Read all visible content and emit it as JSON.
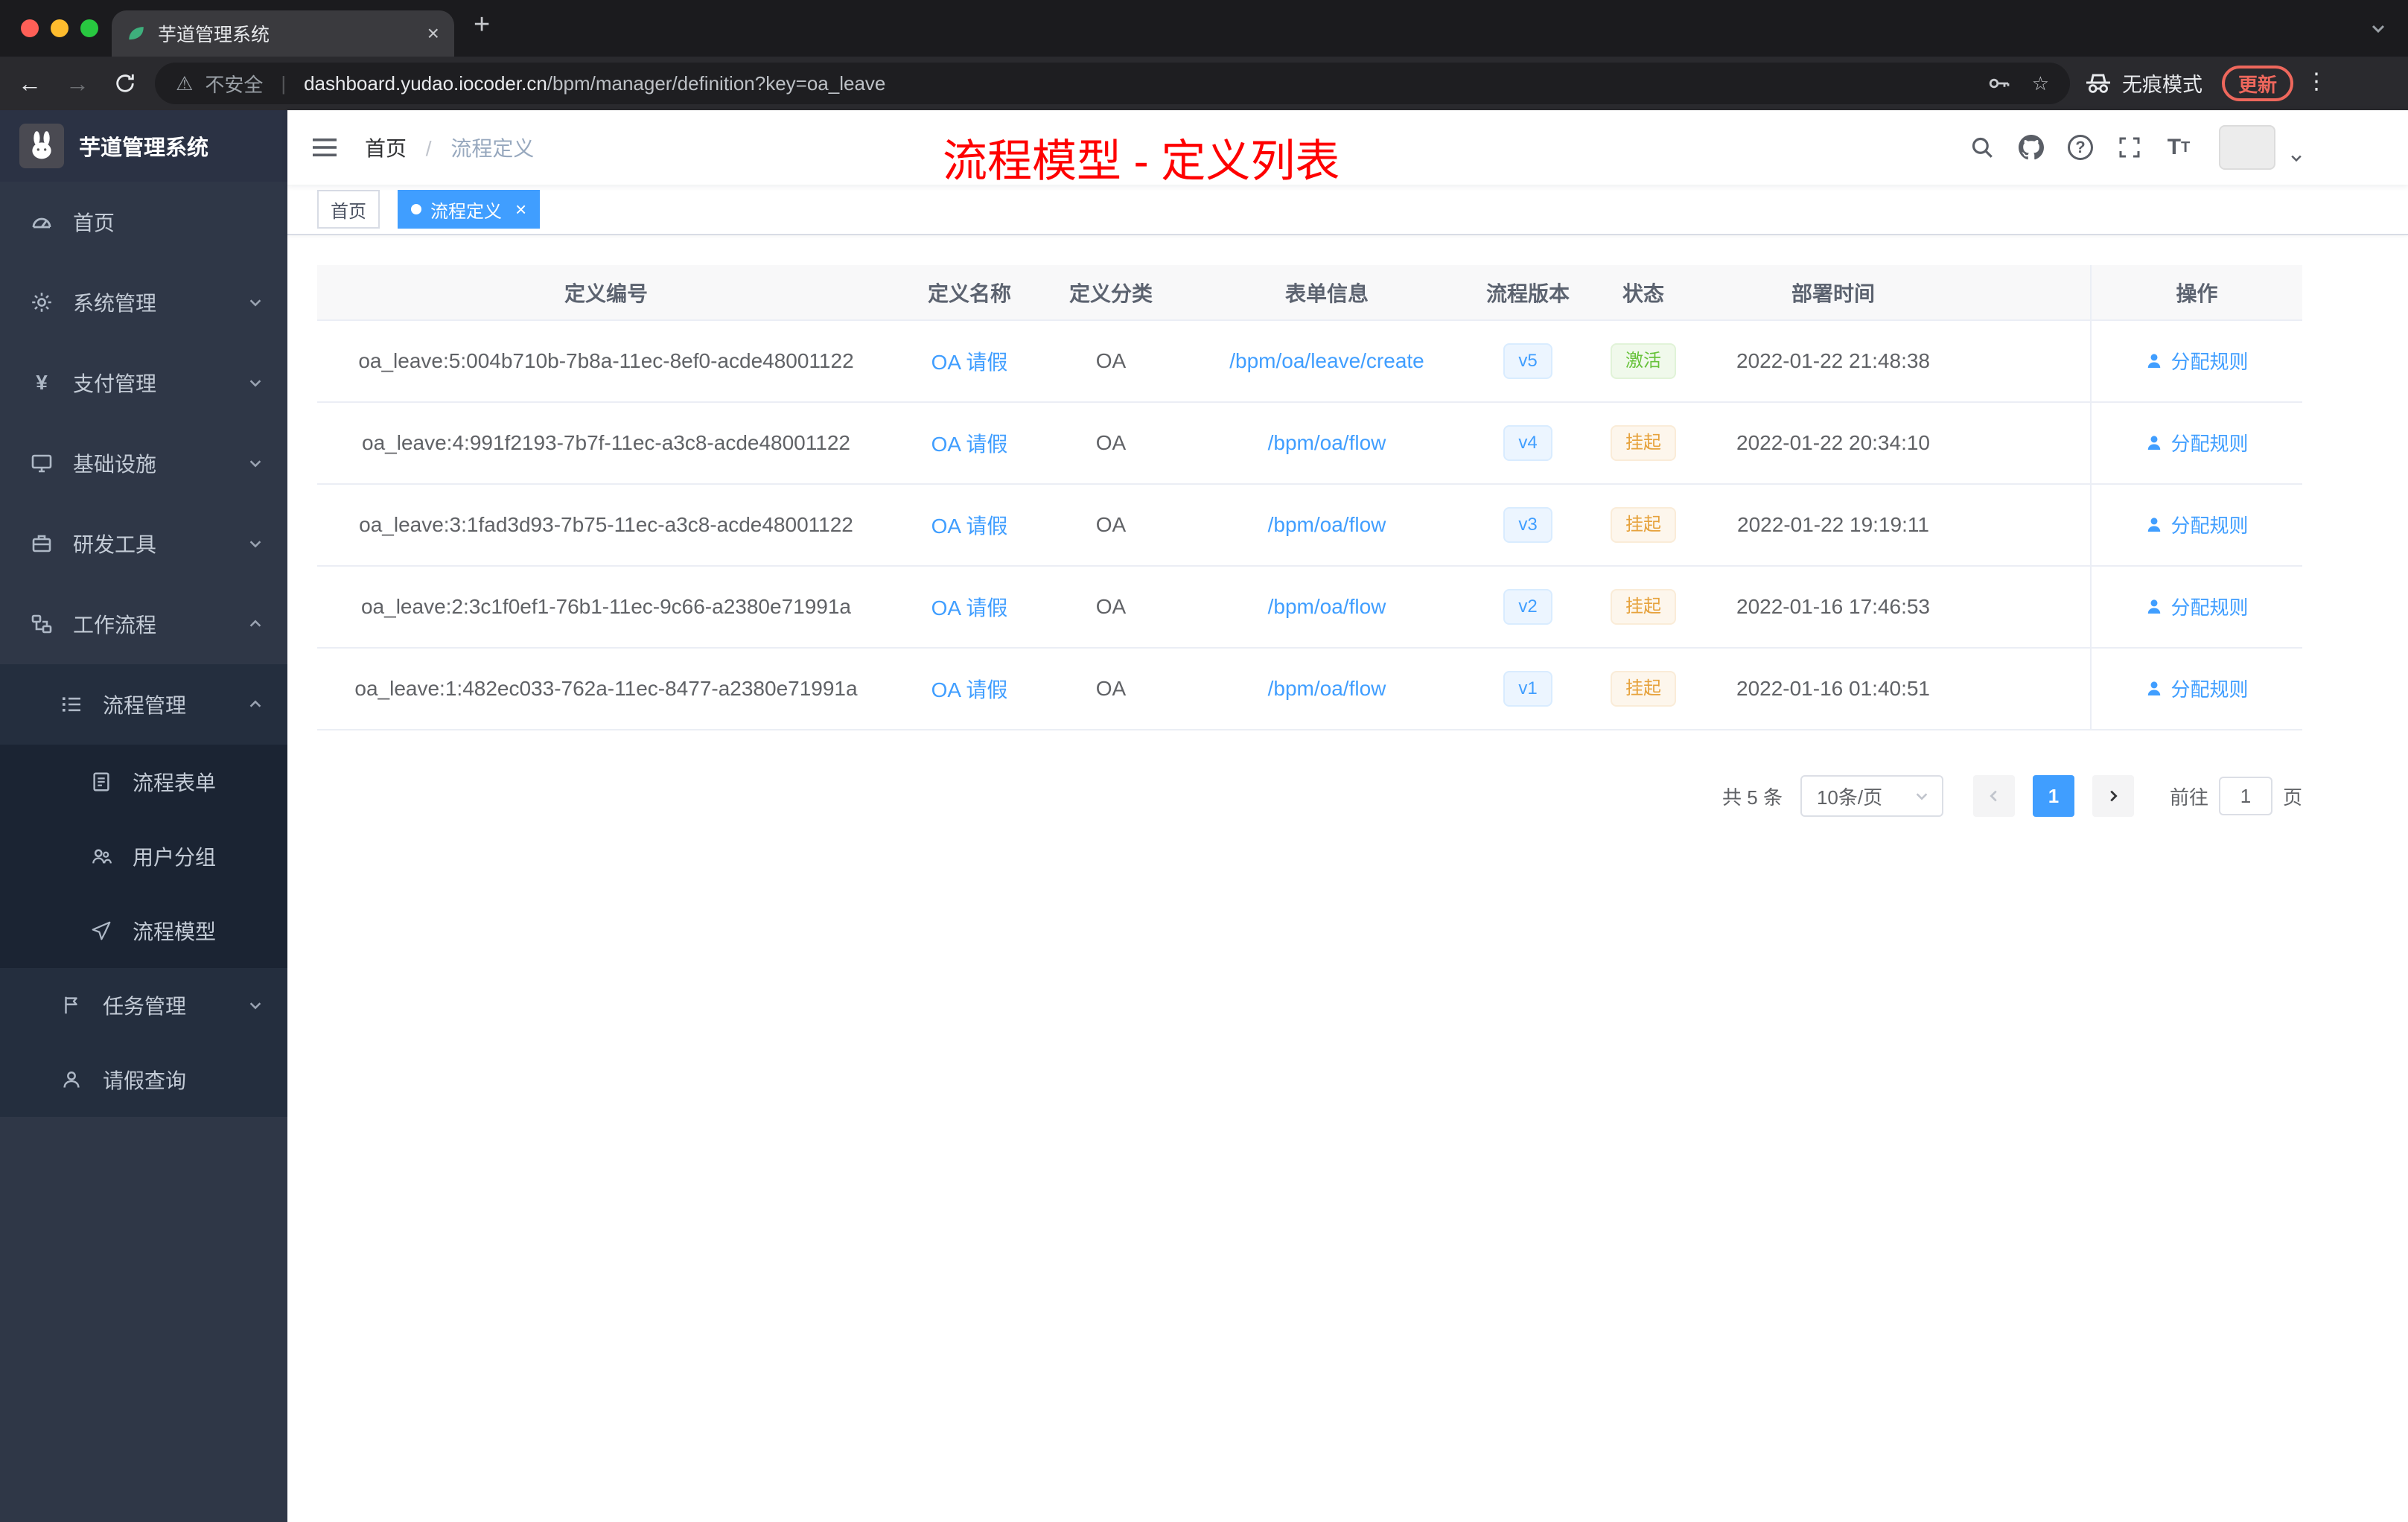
{
  "browser": {
    "tab_title": "芋道管理系统",
    "new_tab": "+",
    "close_tab": "×",
    "security_label": "不安全",
    "url_domain": "dashboard.yudao.iocoder.cn",
    "url_path": "/bpm/manager/definition?key=oa_leave",
    "incognito_label": "无痕模式",
    "update_label": "更新"
  },
  "sidebar": {
    "brand": "芋道管理系统",
    "items": [
      {
        "label": "首页"
      },
      {
        "label": "系统管理"
      },
      {
        "label": "支付管理"
      },
      {
        "label": "基础设施"
      },
      {
        "label": "研发工具"
      },
      {
        "label": "工作流程"
      },
      {
        "label": "流程管理"
      },
      {
        "label": "流程表单"
      },
      {
        "label": "用户分组"
      },
      {
        "label": "流程模型"
      },
      {
        "label": "任务管理"
      },
      {
        "label": "请假查询"
      }
    ]
  },
  "navbar": {
    "breadcrumb_home": "首页",
    "breadcrumb_sep": "/",
    "breadcrumb_current": "流程定义",
    "overlay_title": "流程模型 - 定义列表",
    "question_mark": "?"
  },
  "tags": {
    "home": "首页",
    "current": "流程定义",
    "close": "×"
  },
  "table": {
    "columns": [
      "定义编号",
      "定义名称",
      "定义分类",
      "表单信息",
      "流程版本",
      "状态",
      "部署时间",
      "操作"
    ],
    "action_label": "分配规则",
    "rows": [
      {
        "id": "oa_leave:5:004b710b-7b8a-11ec-8ef0-acde48001122",
        "name": "OA 请假",
        "category": "OA",
        "form": "/bpm/oa/leave/create",
        "version": "v5",
        "status": "激活",
        "time": "2022-01-22 21:48:38"
      },
      {
        "id": "oa_leave:4:991f2193-7b7f-11ec-a3c8-acde48001122",
        "name": "OA 请假",
        "category": "OA",
        "form": "/bpm/oa/flow",
        "version": "v4",
        "status": "挂起",
        "time": "2022-01-22 20:34:10"
      },
      {
        "id": "oa_leave:3:1fad3d93-7b75-11ec-a3c8-acde48001122",
        "name": "OA 请假",
        "category": "OA",
        "form": "/bpm/oa/flow",
        "version": "v3",
        "status": "挂起",
        "time": "2022-01-22 19:19:11"
      },
      {
        "id": "oa_leave:2:3c1f0ef1-76b1-11ec-9c66-a2380e71991a",
        "name": "OA 请假",
        "category": "OA",
        "form": "/bpm/oa/flow",
        "version": "v2",
        "status": "挂起",
        "time": "2022-01-16 17:46:53"
      },
      {
        "id": "oa_leave:1:482ec033-762a-11ec-8477-a2380e71991a",
        "name": "OA 请假",
        "category": "OA",
        "form": "/bpm/oa/flow",
        "version": "v1",
        "status": "挂起",
        "time": "2022-01-16 01:40:51"
      }
    ]
  },
  "pagination": {
    "total": "共 5 条",
    "page_size": "10条/页",
    "current_page": "1",
    "goto_label": "前往",
    "goto_value": "1",
    "goto_suffix": "页"
  },
  "colors": {
    "accent": "#409eff",
    "status_active": "#67c23a",
    "status_suspended": "#e6a23c",
    "annotation_red": "#fe0000"
  }
}
